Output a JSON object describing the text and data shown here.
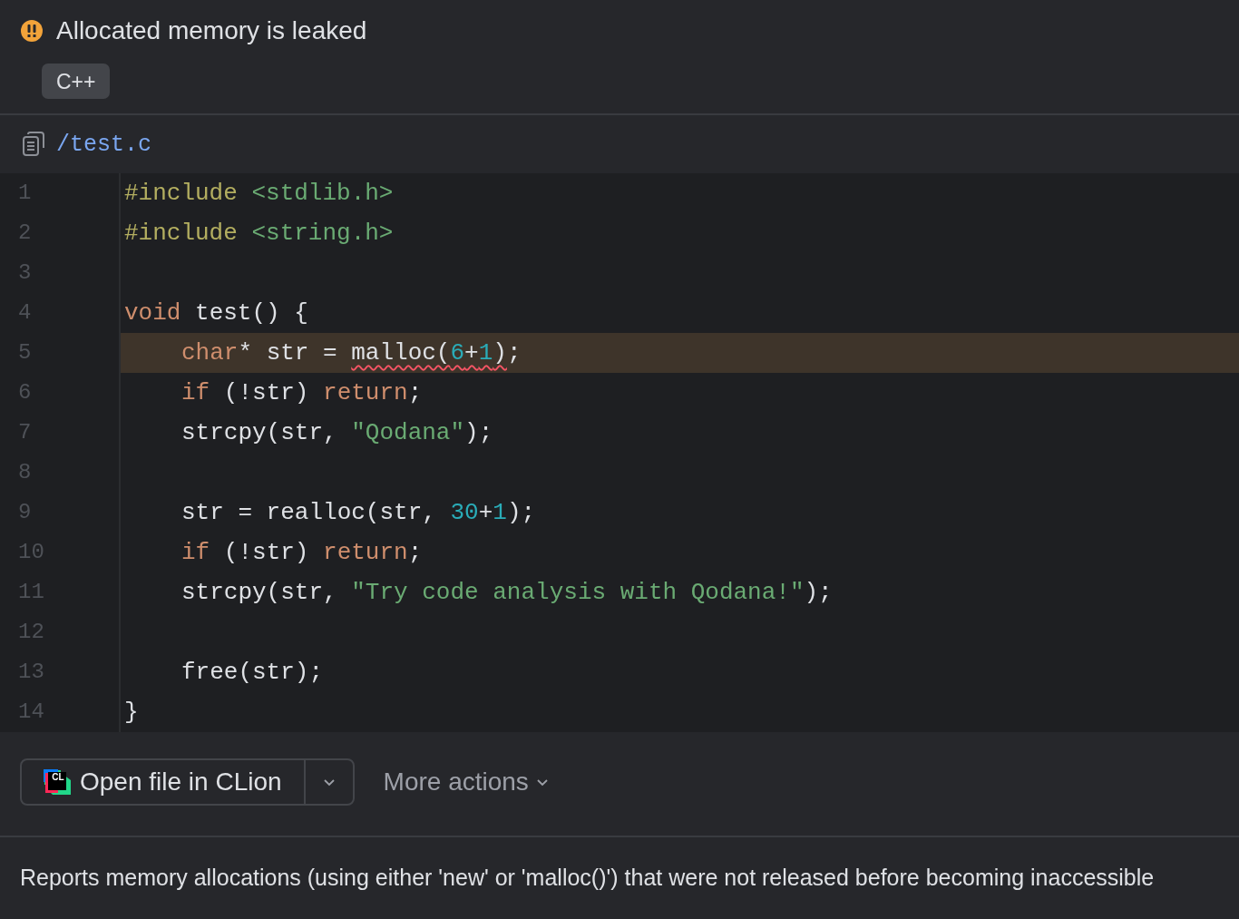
{
  "problem": {
    "title": "Allocated memory is leaked",
    "tags": [
      "C++"
    ]
  },
  "file": {
    "path": "/test.c"
  },
  "code": {
    "lines": [
      {
        "number": "1",
        "highlighted": false,
        "tokens": [
          {
            "t": "#include ",
            "kind": "directive"
          },
          {
            "t": "<stdlib.h>",
            "kind": "header"
          }
        ]
      },
      {
        "number": "2",
        "highlighted": false,
        "tokens": [
          {
            "t": "#include ",
            "kind": "directive"
          },
          {
            "t": "<string.h>",
            "kind": "header"
          }
        ]
      },
      {
        "number": "3"
      },
      {
        "number": "4",
        "highlighted": false,
        "tokens": [
          {
            "t": "void",
            "kind": "keyword"
          },
          {
            "t": " test() {",
            "kind": "plain"
          }
        ],
        "children": [
          {
            "number": "5",
            "highlighted": true,
            "tokens": [
              {
                "t": "char",
                "kind": "keyword"
              },
              {
                "t": "* str = ",
                "kind": "plain"
              },
              {
                "kind": "error",
                "tokens": [
                  {
                    "t": "malloc(",
                    "kind": "plain"
                  },
                  {
                    "t": "6",
                    "kind": "number"
                  },
                  {
                    "t": "+",
                    "kind": "plain"
                  },
                  {
                    "t": "1",
                    "kind": "number"
                  },
                  {
                    "t": ")",
                    "kind": "plain"
                  }
                ]
              },
              {
                "t": ";",
                "kind": "plain"
              }
            ]
          },
          {
            "number": "6",
            "highlighted": false,
            "tokens": [
              {
                "t": "if",
                "kind": "keyword"
              },
              {
                "t": " (!str) ",
                "kind": "plain"
              },
              {
                "t": "return",
                "kind": "keyword"
              },
              {
                "t": ";",
                "kind": "plain"
              }
            ]
          },
          {
            "number": "7",
            "highlighted": false,
            "tokens": [
              {
                "t": "strcpy(str, ",
                "kind": "plain"
              },
              {
                "t": "\"Qodana\"",
                "kind": "string"
              },
              {
                "t": ");",
                "kind": "plain"
              }
            ]
          },
          {
            "number": "8"
          },
          {
            "number": "9",
            "highlighted": false,
            "tokens": [
              {
                "t": "str = realloc(str, ",
                "kind": "plain"
              },
              {
                "t": "30",
                "kind": "number"
              },
              {
                "t": "+",
                "kind": "plain"
              },
              {
                "t": "1",
                "kind": "number"
              },
              {
                "t": ");",
                "kind": "plain"
              }
            ]
          },
          {
            "number": "10",
            "highlighted": false,
            "tokens": [
              {
                "t": "if",
                "kind": "keyword"
              },
              {
                "t": " (!str) ",
                "kind": "plain"
              },
              {
                "t": "return",
                "kind": "keyword"
              },
              {
                "t": ";",
                "kind": "plain"
              }
            ]
          },
          {
            "number": "11",
            "highlighted": false,
            "tokens": [
              {
                "t": "strcpy(str, ",
                "kind": "plain"
              },
              {
                "t": "\"Try code analysis with Qodana!\"",
                "kind": "string"
              },
              {
                "t": ");",
                "kind": "plain"
              }
            ]
          },
          {
            "number": "12"
          },
          {
            "number": "13",
            "highlighted": false,
            "tokens": [
              {
                "t": "free(str);",
                "kind": "plain"
              }
            ]
          }
        ]
      },
      {
        "number": "14",
        "highlighted": false,
        "tokens": [
          {
            "t": "}",
            "kind": "plain"
          }
        ]
      }
    ]
  },
  "actions": {
    "open_button": {
      "logo_text": "CL",
      "label": "Open file in CLion"
    },
    "more_actions": "More actions"
  },
  "description": "Reports memory allocations (using either 'new' or 'malloc()') that were not released before becoming inaccessible"
}
